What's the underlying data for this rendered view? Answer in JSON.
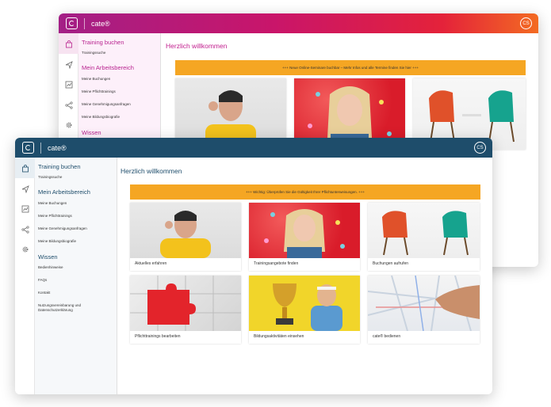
{
  "app": {
    "name": "cate®",
    "avatar_initials": "CS"
  },
  "sidebar": {
    "section_training": "Training buchen",
    "training_items": [
      "Trainingssuche"
    ],
    "section_work": "Mein Arbeitsbereich",
    "work_items": [
      "Meine Buchungen",
      "Meine Pflichttrainings",
      "Meine Genehmigungsanfragen",
      "Meine Bildungsbiografie"
    ],
    "section_wissen": "Wissen",
    "wissen_items": [
      "Bedienhinweise",
      "FAQs",
      "Kontakt",
      "Nutzungsvereinbarung und",
      "Datenschutzerklärung"
    ]
  },
  "main": {
    "greeting": "Herzlich willkommen"
  },
  "back_window": {
    "banner": "+++ Neue Online-Seminare buchbar – Mehr Infos und alle Termine finden Sie hier +++"
  },
  "front_window": {
    "banner": "+++ Wichtig: Überprüfen Sie die Gültigkeit Ihrer Pflichtunterweisungen. +++",
    "tiles": [
      {
        "caption": "Aktuelles erfahren"
      },
      {
        "caption": "Trainingsangebote finden"
      },
      {
        "caption": "Buchungen aufrufen"
      },
      {
        "caption": "Pflichttrainings bearbeiten"
      },
      {
        "caption": "Bildungsaktivitäten einsehen"
      },
      {
        "caption": "cate® bedienen"
      }
    ]
  },
  "colors": {
    "front_header": "#1e4d6b",
    "back_header_start": "#a31f86",
    "back_header_end": "#f36b22",
    "banner": "#f5a623"
  },
  "icons": [
    "shopping-bag-icon",
    "send-icon",
    "chart-icon",
    "share-icon",
    "gear-icon"
  ]
}
